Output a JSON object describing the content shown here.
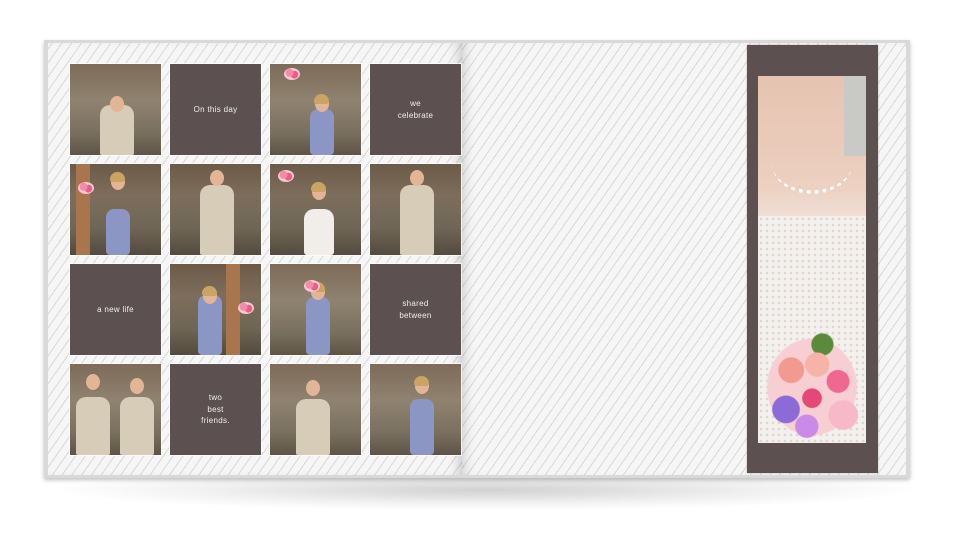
{
  "album": {
    "grid_tiles": [
      {
        "kind": "photo",
        "subject": "groom-jumping"
      },
      {
        "kind": "text",
        "text": "On this day"
      },
      {
        "kind": "photo",
        "subject": "bridesmaid-bouquet"
      },
      {
        "kind": "text",
        "text": "we\ncelebrate"
      },
      {
        "kind": "photo",
        "subject": "bridesmaid-posing"
      },
      {
        "kind": "photo",
        "subject": "groomsmen-waving"
      },
      {
        "kind": "photo",
        "subject": "bride-bouquet"
      },
      {
        "kind": "photo",
        "subject": "groom-suit"
      },
      {
        "kind": "text",
        "text": "a new life"
      },
      {
        "kind": "photo",
        "subject": "bridesmaid-dancing"
      },
      {
        "kind": "photo",
        "subject": "bridesmaid-cheering"
      },
      {
        "kind": "text",
        "text": "shared\nbetween"
      },
      {
        "kind": "photo",
        "subject": "groomsmen-pair"
      },
      {
        "kind": "text",
        "text": "two\nbest\nfriends."
      },
      {
        "kind": "photo",
        "subject": "groom-smiling"
      },
      {
        "kind": "photo",
        "subject": "bridesmaid-arms-out"
      }
    ],
    "accent_color": "#5c5050",
    "strip_photo": {
      "subject": "bride-pearl-necklace-bouquet"
    }
  }
}
